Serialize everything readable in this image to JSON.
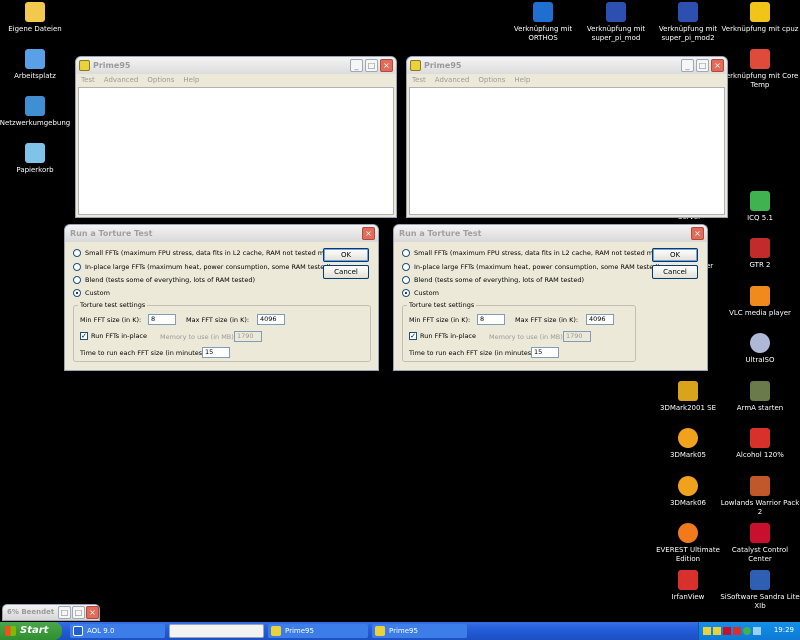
{
  "desktop_icons_left": [
    {
      "label": "Eigene Dateien",
      "color": "#f2c94c"
    },
    {
      "label": "Arbeitsplatz",
      "color": "#5aa0e6"
    },
    {
      "label": "Netzwerkumgebung",
      "color": "#3f8fd2"
    },
    {
      "label": "Papierkorb",
      "color": "#7fc4e8"
    }
  ],
  "desktop_icons_top": [
    {
      "label1": "Verknüpfung mit",
      "label2": "ORTHOS",
      "color": "#1e6fd0"
    },
    {
      "label1": "Verknüpfung mit",
      "label2": "super_pi_mod",
      "color": "#2d4fb0"
    },
    {
      "label1": "Verknüpfung mit",
      "label2": "super_pi_mod2",
      "color": "#2d4fb0"
    },
    {
      "label1": "Verknüpfung mit cpuz",
      "label2": "",
      "color": "#f0c419"
    }
  ],
  "desktop_icons_right": [
    {
      "label": "Verknüpfung mit Core Temp",
      "color": "#e04a3a"
    },
    {
      "label": "ICQ 5.1",
      "color": "#3fb34f"
    },
    {
      "label": "GTR 2",
      "color": "#c22b2b"
    },
    {
      "label": "VLC media player",
      "color": "#f08a1c"
    },
    {
      "label": "UltraISO",
      "color": "#b0b8d8"
    },
    {
      "label": "ArmA starten",
      "color": "#6a7a4a"
    },
    {
      "label": "Alcohol 120%",
      "color": "#d8312b"
    },
    {
      "label": "Lowlands Warrior Pack 2",
      "color": "#c0582a"
    },
    {
      "label": "Catalyst Control Center",
      "color": "#c8102e"
    },
    {
      "label": "SiSoftware Sandra Lite XIb",
      "color": "#2f5fb3"
    }
  ],
  "desktop_icons_right2": [
    {
      "label": "3DMark2001 SE",
      "color": "#d8a41c"
    },
    {
      "label": "3DMark05",
      "color": "#f0a21c"
    },
    {
      "label": "3DMark06",
      "color": "#f0a21c"
    },
    {
      "label": "EVEREST Ultimate Edition",
      "color": "#f07a1c"
    },
    {
      "label": "IrfanView",
      "color": "#d8312b"
    }
  ],
  "partial_labels": {
    "server": "Server",
    "er": "er"
  },
  "prime_window": {
    "title": "Prime95",
    "menu": [
      "Test",
      "Advanced",
      "Options",
      "Help"
    ]
  },
  "dialog": {
    "title": "Run a Torture Test",
    "options": [
      "Small FFTs (maximum FPU stress, data fits in L2 cache, RAM not tested much)",
      "In-place large FFTs (maximum heat, power consumption, some RAM tested)",
      "Blend (tests some of everything, lots of RAM tested)",
      "Custom"
    ],
    "selected_option": "Custom",
    "ok": "OK",
    "cancel": "Cancel",
    "group_title": "Torture test settings",
    "min_fft_label": "Min FFT size (in K):",
    "min_fft_value": "8",
    "max_fft_label": "Max FFT size (in K):",
    "max_fft_value": "4096",
    "run_inplace_label": "Run FFTs in-place",
    "run_inplace_checked": true,
    "memory_label": "Memory to use (in MB):",
    "memory_value": "1790",
    "time_label": "Time to run each FFT size (in minutes):",
    "time_value": "15"
  },
  "minimized": {
    "title": "6% Beendet"
  },
  "taskbar": {
    "start": "Start",
    "items": [
      "AOL 9.0",
      "",
      "Prime95",
      "Prime95"
    ],
    "clock": "19:29"
  }
}
